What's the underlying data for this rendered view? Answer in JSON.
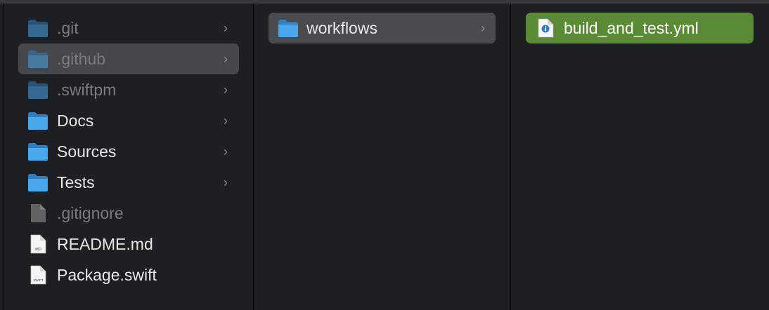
{
  "columns": [
    {
      "items": [
        {
          "label": ".git",
          "icon": "folder-icon",
          "has_children": true,
          "dim": true
        },
        {
          "label": ".github",
          "icon": "folder-icon",
          "has_children": true,
          "dim": true,
          "highlighted": true
        },
        {
          "label": ".swiftpm",
          "icon": "folder-icon",
          "has_children": true,
          "dim": true
        },
        {
          "label": "Docs",
          "icon": "folder-icon",
          "has_children": true,
          "dim": false
        },
        {
          "label": "Sources",
          "icon": "folder-icon",
          "has_children": true,
          "dim": false
        },
        {
          "label": "Tests",
          "icon": "folder-icon",
          "has_children": true,
          "dim": false
        },
        {
          "label": ".gitignore",
          "icon": "document-icon",
          "has_children": false,
          "dim": true
        },
        {
          "label": "README.md",
          "icon": "md-file-icon",
          "badge": "MD",
          "has_children": false,
          "dim": false
        },
        {
          "label": "Package.swift",
          "icon": "swift-file-icon",
          "badge": "SWIFT",
          "has_children": false,
          "dim": false
        }
      ]
    },
    {
      "items": [
        {
          "label": "workflows",
          "icon": "folder-icon",
          "has_children": true,
          "dim": false,
          "highlighted": true
        }
      ]
    },
    {
      "items": [
        {
          "label": "build_and_test.yml",
          "icon": "yml-file-icon",
          "has_children": false,
          "dim": false,
          "selected": true
        }
      ]
    }
  ],
  "colors": {
    "background": "#1e1f22",
    "selection": "#5a8a36",
    "highlight": "#46474a",
    "folder": "#4aa7ea"
  }
}
